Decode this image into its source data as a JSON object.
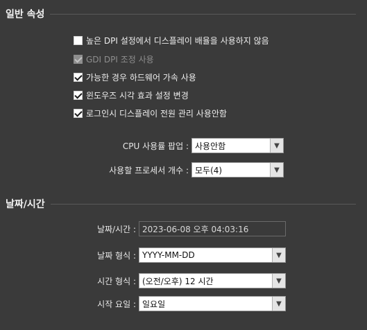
{
  "general": {
    "title": "일반 속성",
    "options": [
      {
        "label": "높은 DPI 설정에서 디스플레이 배율을 사용하지 않음",
        "checked": false,
        "disabled": false
      },
      {
        "label": "GDI DPI 조정 사용",
        "checked": true,
        "disabled": true
      },
      {
        "label": "가능한 경우 하드웨어 가속 사용",
        "checked": true,
        "disabled": false
      },
      {
        "label": "윈도우즈 시각 효과 설정 변경",
        "checked": true,
        "disabled": false
      },
      {
        "label": "로그인시 디스플레이 전원 관리 사용안함",
        "checked": true,
        "disabled": false
      }
    ],
    "cpu_usage": {
      "label": "CPU 사용률 팝업 :",
      "value": "사용안함"
    },
    "processor_count": {
      "label": "사용할 프로세서 개수 :",
      "value": "모두(4)"
    }
  },
  "datetime": {
    "title": "날짜/시간",
    "current": {
      "label": "날짜/시간 :",
      "value": "2023-06-08 오후 04:03:16"
    },
    "date_format": {
      "label": "날짜 형식 :",
      "value": "YYYY-MM-DD"
    },
    "time_format": {
      "label": "시간 형식 :",
      "value": "(오전/오후) 12 시간"
    },
    "week_start": {
      "label": "시작 요일 :",
      "value": "일요일"
    }
  },
  "icons": {
    "dropdown": "chevron-down-icon",
    "check": "checkmark-icon"
  }
}
